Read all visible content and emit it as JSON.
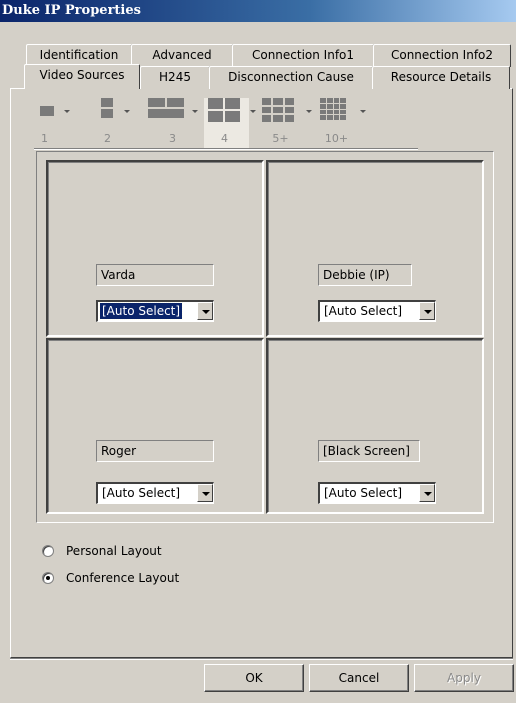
{
  "window": {
    "title": "Duke IP Properties"
  },
  "tabs": {
    "row_back": [
      "Identification",
      "Advanced",
      "Connection Info1",
      "Connection Info2"
    ],
    "row_front": [
      "Video Sources",
      "H245",
      "Disconnection Cause",
      "Resource Details"
    ],
    "active": "Video Sources"
  },
  "layouts": {
    "items": [
      {
        "label": "1",
        "grid": "1x1"
      },
      {
        "label": "2",
        "grid": "1x2"
      },
      {
        "label": "3",
        "grid": "2x2-top"
      },
      {
        "label": "4",
        "grid": "2x2"
      },
      {
        "label": "5+",
        "grid": "3x3"
      },
      {
        "label": "10+",
        "grid": "4x4"
      }
    ],
    "selected": "4"
  },
  "video_cells": [
    {
      "name": "Varda",
      "source": "[Auto Select]",
      "selected": true
    },
    {
      "name": "Debbie (IP)",
      "source": "[Auto Select]",
      "selected": false
    },
    {
      "name": "Roger",
      "source": "[Auto Select]",
      "selected": false
    },
    {
      "name": "[Black Screen]",
      "source": "[Auto Select]",
      "selected": false
    }
  ],
  "layout_mode": {
    "options": [
      "Personal Layout",
      "Conference Layout"
    ],
    "selected": "Conference Layout"
  },
  "buttons": {
    "ok": "OK",
    "cancel": "Cancel",
    "apply": "Apply"
  },
  "colors": {
    "face": "#d4d0c8",
    "title_start": "#0a246a",
    "selection": "#0a246a",
    "tile": "#7a7a7a"
  }
}
